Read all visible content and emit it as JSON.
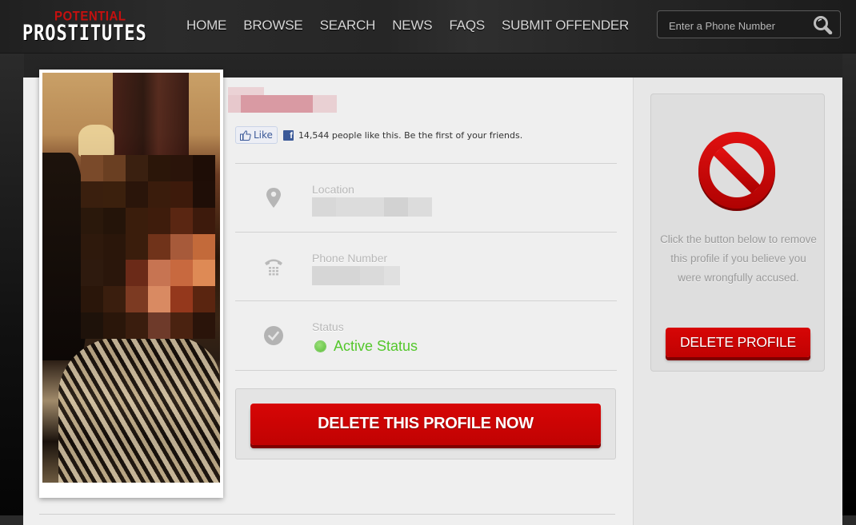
{
  "header": {
    "logo": {
      "top_text": "POTENTIAL",
      "main_text": "PROSTITUTES"
    },
    "nav": [
      {
        "label": "HOME"
      },
      {
        "label": "BROWSE"
      },
      {
        "label": "SEARCH"
      },
      {
        "label": "NEWS"
      },
      {
        "label": "FAQS"
      },
      {
        "label": "SUBMIT OFFENDER"
      }
    ],
    "search": {
      "placeholder": "Enter a Phone Number",
      "value": "",
      "icon": "magnifier-icon"
    }
  },
  "profile": {
    "photo": {
      "alt": "Profile photo (face pixelated)"
    },
    "name": "[redacted]",
    "facebook": {
      "like_label": "Like",
      "like_text": "14,544 people like this. Be the first of your friends."
    },
    "fields": [
      {
        "label": "Location",
        "value": "[redacted]",
        "icon": "map-pin-icon"
      },
      {
        "label": "Phone Number",
        "value": "[redacted]",
        "icon": "telephone-icon"
      },
      {
        "label": "Status",
        "value": "Active Status",
        "icon": "check-badge-icon",
        "status_color": "#54c72c"
      }
    ],
    "delete_now_label": "DELETE THIS PROFILE NOW"
  },
  "sidebar": {
    "icon": "prohibited-icon",
    "message": "Click the button below to remove this profile if you believe you were wrongfully accused.",
    "delete_label": "DELETE PROFILE"
  },
  "colors": {
    "accent_red": "#c90404",
    "status_green": "#54c72c",
    "facebook_blue": "#3b5998"
  }
}
